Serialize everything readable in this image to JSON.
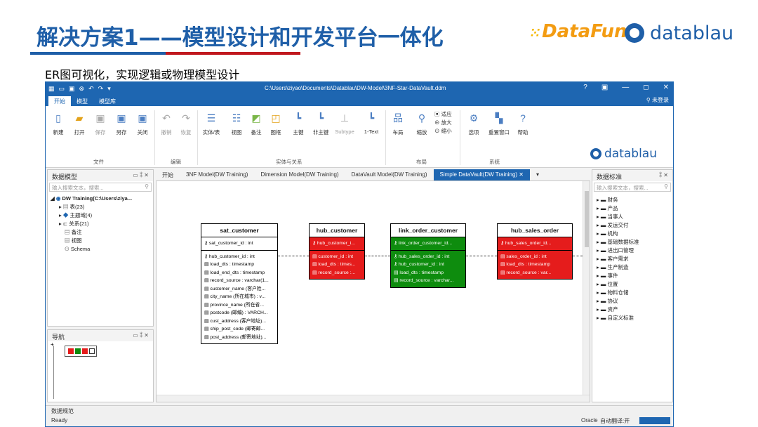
{
  "slide": {
    "title": "解决方案1——模型设计和开发平台一体化",
    "subtitle": "ER图可视化，实现逻辑或物理模型设计",
    "logo_datafun": "DataFun.",
    "logo_datablau": "datablau",
    "colors": {
      "title_blue": "#1f5fa8",
      "rule_red": "#c0181e",
      "app_blue": "#1e66b1",
      "entity_red": "#e51c1c",
      "entity_green": "#0e8c0e"
    }
  },
  "window": {
    "path": "C:\\Users\\ziyao\\Documents\\Datablau\\DW-Model\\3NF-Star-DataVault.ddm",
    "controls": [
      "?",
      "▣",
      "—",
      "◻",
      "✕"
    ],
    "ribbon_tabs": [
      "开始",
      "模型",
      "模型库"
    ],
    "login": "未登录"
  },
  "ribbon": {
    "buttons": [
      {
        "label": "新建",
        "icon": "new-file-icon"
      },
      {
        "label": "打开",
        "icon": "open-folder-icon"
      },
      {
        "label": "保存",
        "icon": "save-icon"
      },
      {
        "label": "另存",
        "icon": "save-as-icon"
      },
      {
        "label": "关闭",
        "icon": "close-file-icon"
      },
      {
        "label": "撤销",
        "icon": "undo-icon"
      },
      {
        "label": "恢复",
        "icon": "redo-icon"
      },
      {
        "label": "实体/表",
        "icon": "table-icon"
      },
      {
        "label": "视图",
        "icon": "view-icon"
      },
      {
        "label": "备注",
        "icon": "note-icon"
      },
      {
        "label": "图框",
        "icon": "frame-icon"
      },
      {
        "label": "主键",
        "icon": "primary-key-icon"
      },
      {
        "label": "非主键",
        "icon": "non-primary-key-icon"
      },
      {
        "label": "Subtype",
        "icon": "subtype-icon"
      },
      {
        "label": "1-Text",
        "icon": "one-text-icon"
      },
      {
        "label": "布局",
        "icon": "layout-icon"
      },
      {
        "label": "缩放",
        "icon": "zoom-icon"
      },
      {
        "label": "选项",
        "icon": "gear-icon"
      },
      {
        "label": "重置窗口",
        "icon": "reset-window-icon"
      },
      {
        "label": "帮助",
        "icon": "help-icon"
      }
    ],
    "zoom_options": [
      "适应",
      "放大",
      "缩小"
    ],
    "groups": [
      "文件",
      "编辑",
      "实体与关系",
      "布局",
      "系统"
    ]
  },
  "left_panel": {
    "title": "数据模型",
    "controls": "▭ ⁑ ✕",
    "search_placeholder": "输入搜索文本，搜索...",
    "tree": [
      "DW Training(C:\\Users\\ziya...",
      "表(23)",
      "主题域(4)",
      "关系(21)",
      "备注",
      "视图",
      "Schema"
    ]
  },
  "nav_panel": {
    "title": "导航",
    "controls": "▭ ⁑ ✕"
  },
  "doc_tabs": [
    {
      "label": "开始"
    },
    {
      "label": "3NF Model(DW Training)"
    },
    {
      "label": "Dimension Model(DW Training)"
    },
    {
      "label": "DataVault Model(DW Training)"
    },
    {
      "label": "Simple DataVault(DW Training)  ✕"
    }
  ],
  "entities": {
    "sat_customer": {
      "name": "sat_customer",
      "pk": [
        "sat_customer_id : int"
      ],
      "cols": [
        "hub_customer_id : int",
        "load_dts : timestamp",
        "load_end_dts : timestamp",
        "record_source : varchar(1...",
        "customer_name (客户姓...",
        "city_name (所在城市) : v...",
        "province_name (所在省...",
        "postcode (邮编) : VARCH...",
        "cust_address (客户地址)...",
        "ship_post_code (邮寄邮...",
        "post_address (邮寄地址)..."
      ]
    },
    "hub_customer": {
      "name": "hub_customer",
      "pk": [
        "hub_customer_i..."
      ],
      "cols": [
        "customer_id : int",
        "load_dts : times...",
        "record_source :..."
      ]
    },
    "link_order_customer": {
      "name": "link_order_customer",
      "pk": [
        "link_order_customer_id..."
      ],
      "cols": [
        "hub_sales_order_id : int",
        "hub_customer_id : int",
        "load_dts : timestamp",
        "record_source : varchar..."
      ]
    },
    "hub_sales_order": {
      "name": "hub_sales_order",
      "pk": [
        "hub_sales_order_id..."
      ],
      "cols": [
        "sales_order_id : int",
        "load_dts : timestamp",
        "record_source : var..."
      ]
    }
  },
  "right_panel": {
    "title": "数据标准",
    "controls": "⁑ ✕",
    "search_placeholder": "输入搜索文本，搜索...",
    "items": [
      "财务",
      "产品",
      "当事人",
      "发运交付",
      "机构",
      "基础数据标准",
      "进出口管理",
      "客户需求",
      "生产制造",
      "事件",
      "位置",
      "物料仓储",
      "协议",
      "资产",
      "自定义标准"
    ]
  },
  "status": {
    "section": "数据规范",
    "state": "Ready",
    "db": "Oracle",
    "translate": "自动翻译:开"
  }
}
